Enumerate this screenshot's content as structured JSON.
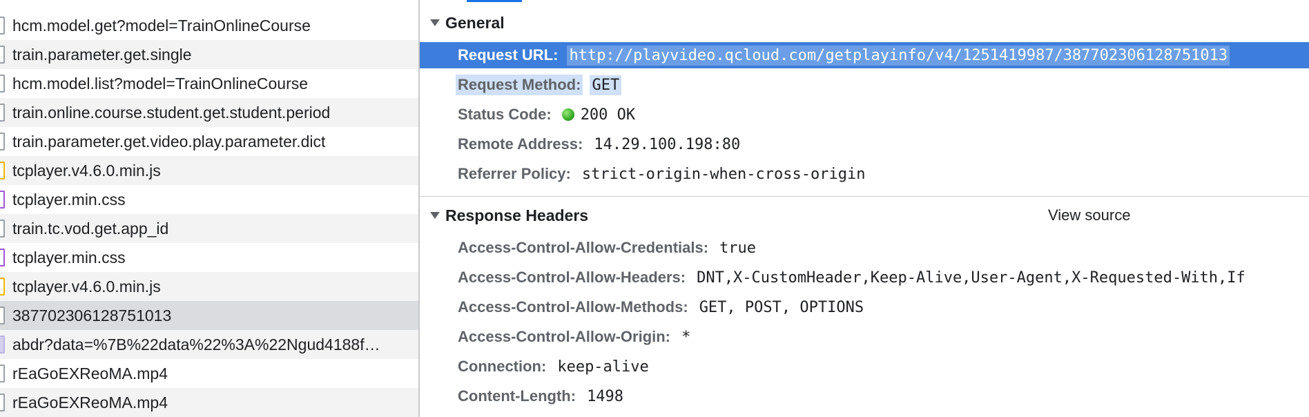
{
  "request_list": {
    "items": [
      {
        "name": "hcm.model.get?model=TrainOnlineCourse",
        "type": "xhr"
      },
      {
        "name": "train.parameter.get.single",
        "type": "xhr"
      },
      {
        "name": "hcm.model.list?model=TrainOnlineCourse",
        "type": "xhr"
      },
      {
        "name": "train.online.course.student.get.student.period",
        "type": "xhr"
      },
      {
        "name": "train.parameter.get.video.play.parameter.dict",
        "type": "xhr"
      },
      {
        "name": "tcplayer.v4.6.0.min.js",
        "type": "js"
      },
      {
        "name": "tcplayer.min.css",
        "type": "css"
      },
      {
        "name": "train.tc.vod.get.app_id",
        "type": "xhr"
      },
      {
        "name": "tcplayer.min.css",
        "type": "css"
      },
      {
        "name": "tcplayer.v4.6.0.min.js",
        "type": "js"
      },
      {
        "name": "387702306128751013",
        "type": "xhr",
        "selected": true
      },
      {
        "name": "abdr?data=%7B%22data%22%3A%22Ngud4188f…",
        "type": "img"
      },
      {
        "name": "rEaGoEXReoMA.mp4",
        "type": "media"
      },
      {
        "name": "rEaGoEXReoMA.mp4",
        "type": "media"
      }
    ]
  },
  "general": {
    "title": "General",
    "request_url_label": "Request URL:",
    "request_url_value": "http://playvideo.qcloud.com/getplayinfo/v4/1251419987/387702306128751013",
    "request_method_label": "Request Method:",
    "request_method_value": "GET",
    "status_code_label": "Status Code:",
    "status_code_value": "200 OK",
    "remote_address_label": "Remote Address:",
    "remote_address_value": "14.29.100.198:80",
    "referrer_policy_label": "Referrer Policy:",
    "referrer_policy_value": "strict-origin-when-cross-origin"
  },
  "response_headers": {
    "title": "Response Headers",
    "view_source_label": "View source",
    "rows": [
      {
        "key": "Access-Control-Allow-Credentials:",
        "value": "true"
      },
      {
        "key": "Access-Control-Allow-Headers:",
        "value": "DNT,X-CustomHeader,Keep-Alive,User-Agent,X-Requested-With,If"
      },
      {
        "key": "Access-Control-Allow-Methods:",
        "value": "GET, POST, OPTIONS"
      },
      {
        "key": "Access-Control-Allow-Origin:",
        "value": "*"
      },
      {
        "key": "Connection:",
        "value": "keep-alive"
      },
      {
        "key": "Content-Length:",
        "value": "1498"
      }
    ]
  },
  "colors": {
    "selection_blue": "#3d7ddb",
    "status_green": "#3bb02a",
    "js_icon": "#f2b705",
    "css_icon": "#a256d8"
  }
}
